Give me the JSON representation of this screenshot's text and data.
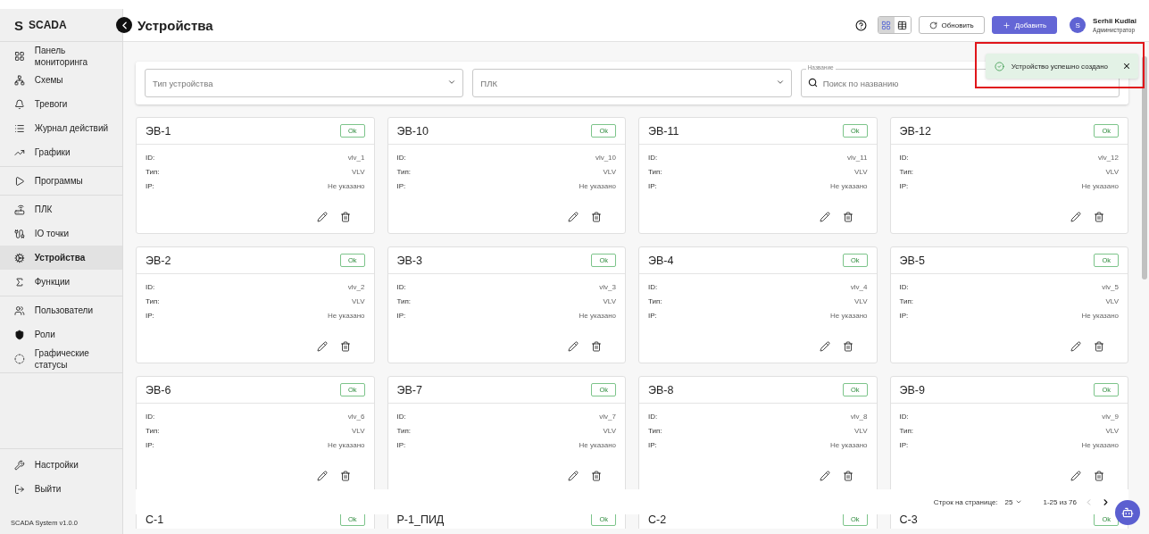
{
  "sidebar": {
    "logo_mark": "S",
    "logo_text": "SCADA",
    "groups": [
      [
        {
          "label": "Панель мониторинга",
          "selected": false
        },
        {
          "label": "Схемы",
          "selected": false
        },
        {
          "label": "Тревоги",
          "selected": false
        },
        {
          "label": "Журнал действий",
          "selected": false
        },
        {
          "label": "Графики",
          "selected": false
        }
      ],
      [
        {
          "label": "Программы",
          "selected": false
        }
      ],
      [
        {
          "label": "ПЛК",
          "selected": false
        },
        {
          "label": "IO точки",
          "selected": false
        },
        {
          "label": "Устройства",
          "selected": true
        },
        {
          "label": "Функции",
          "selected": false
        }
      ],
      [
        {
          "label": "Пользователи",
          "selected": false
        },
        {
          "label": "Роли",
          "selected": false
        },
        {
          "label": "Графические статусы",
          "selected": false
        }
      ]
    ],
    "bottom_items": [
      {
        "label": "Настройки"
      },
      {
        "label": "Выйти"
      }
    ],
    "version": "SCADA System v1.0.0"
  },
  "header": {
    "title": "Устройства",
    "views": [
      {
        "selected": true
      },
      {
        "selected": false
      }
    ],
    "refresh_button": "Обновить",
    "add_button": "Добавить",
    "user": {
      "initial": "S",
      "name": "Serhii Kudlai",
      "role": "Администратор"
    }
  },
  "toast": {
    "message": "Устройство успешно создано"
  },
  "filters": [
    {
      "kind": "select",
      "placeholder": "Тип устройства"
    },
    {
      "kind": "select",
      "placeholder": "ПЛК"
    },
    {
      "kind": "search",
      "label": "Название",
      "placeholder": "Поиск по названию"
    }
  ],
  "devices": [
    {
      "name": "ЭВ-1",
      "status": "Ok",
      "fields": [
        {
          "label": "ID:",
          "value": "vlv_1"
        },
        {
          "label": "Тип:",
          "value": "VLV"
        },
        {
          "label": "IP:",
          "value": "Не указано"
        }
      ]
    },
    {
      "name": "ЭВ-10",
      "status": "Ok",
      "fields": [
        {
          "label": "ID:",
          "value": "vlv_10"
        },
        {
          "label": "Тип:",
          "value": "VLV"
        },
        {
          "label": "IP:",
          "value": "Не указано"
        }
      ]
    },
    {
      "name": "ЭВ-11",
      "status": "Ok",
      "fields": [
        {
          "label": "ID:",
          "value": "vlv_11"
        },
        {
          "label": "Тип:",
          "value": "VLV"
        },
        {
          "label": "IP:",
          "value": "Не указано"
        }
      ]
    },
    {
      "name": "ЭВ-12",
      "status": "Ok",
      "fields": [
        {
          "label": "ID:",
          "value": "vlv_12"
        },
        {
          "label": "Тип:",
          "value": "VLV"
        },
        {
          "label": "IP:",
          "value": "Не указано"
        }
      ]
    },
    {
      "name": "ЭВ-2",
      "status": "Ok",
      "fields": [
        {
          "label": "ID:",
          "value": "vlv_2"
        },
        {
          "label": "Тип:",
          "value": "VLV"
        },
        {
          "label": "IP:",
          "value": "Не указано"
        }
      ]
    },
    {
      "name": "ЭВ-3",
      "status": "Ok",
      "fields": [
        {
          "label": "ID:",
          "value": "vlv_3"
        },
        {
          "label": "Тип:",
          "value": "VLV"
        },
        {
          "label": "IP:",
          "value": "Не указано"
        }
      ]
    },
    {
      "name": "ЭВ-4",
      "status": "Ok",
      "fields": [
        {
          "label": "ID:",
          "value": "vlv_4"
        },
        {
          "label": "Тип:",
          "value": "VLV"
        },
        {
          "label": "IP:",
          "value": "Не указано"
        }
      ]
    },
    {
      "name": "ЭВ-5",
      "status": "Ok",
      "fields": [
        {
          "label": "ID:",
          "value": "vlv_5"
        },
        {
          "label": "Тип:",
          "value": "VLV"
        },
        {
          "label": "IP:",
          "value": "Не указано"
        }
      ]
    },
    {
      "name": "ЭВ-6",
      "status": "Ok",
      "fields": [
        {
          "label": "ID:",
          "value": "vlv_6"
        },
        {
          "label": "Тип:",
          "value": "VLV"
        },
        {
          "label": "IP:",
          "value": "Не указано"
        }
      ]
    },
    {
      "name": "ЭВ-7",
      "status": "Ok",
      "fields": [
        {
          "label": "ID:",
          "value": "vlv_7"
        },
        {
          "label": "Тип:",
          "value": "VLV"
        },
        {
          "label": "IP:",
          "value": "Не указано"
        }
      ]
    },
    {
      "name": "ЭВ-8",
      "status": "Ok",
      "fields": [
        {
          "label": "ID:",
          "value": "vlv_8"
        },
        {
          "label": "Тип:",
          "value": "VLV"
        },
        {
          "label": "IP:",
          "value": "Не указано"
        }
      ]
    },
    {
      "name": "ЭВ-9",
      "status": "Ok",
      "fields": [
        {
          "label": "ID:",
          "value": "vlv_9"
        },
        {
          "label": "Тип:",
          "value": "VLV"
        },
        {
          "label": "IP:",
          "value": "Не указано"
        }
      ]
    },
    {
      "name": "С-1",
      "status": "Ok"
    },
    {
      "name": "Р-1_ПИД",
      "status": "Ok"
    },
    {
      "name": "С-2",
      "status": "Ok"
    },
    {
      "name": "С-3",
      "status": "Ok"
    }
  ],
  "pagination": {
    "rows_label": "Строк на странице:",
    "rows_value": "25",
    "range": "1-25 из 76",
    "prev_disabled": true,
    "next_disabled": false
  }
}
